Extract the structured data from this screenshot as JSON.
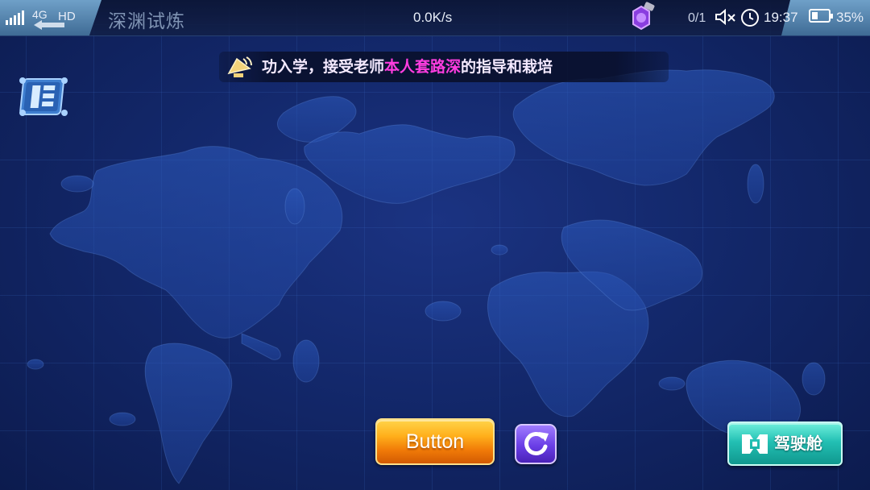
{
  "status_bar": {
    "network": "4G",
    "hd": "HD",
    "title": "深渊试炼",
    "speed": "0.0K/s",
    "counter": "0/1",
    "time": "19:37",
    "battery_level": "35%",
    "battery_fraction": 0.35
  },
  "banner": {
    "text_before": "功入学，接受老师",
    "highlight": "本人套路深",
    "text_after": "的指导和栽培",
    "highlight_color": "#ff3de0"
  },
  "buttons": {
    "main_label": "Button",
    "cockpit_label": "驾驶舱"
  },
  "icons": {
    "menu": "scroll-menu-icon",
    "speaker": "speaker-icon",
    "refresh": "refresh-icon",
    "cockpit": "cockpit-icon",
    "notification": "purple-gear-icon",
    "mute": "mute-icon",
    "alarm": "alarm-icon"
  },
  "colors": {
    "background": "#13286b",
    "main_button": "#ffae1a",
    "refresh_button": "#6a3ee6",
    "cockpit_button": "#23c0b4"
  }
}
